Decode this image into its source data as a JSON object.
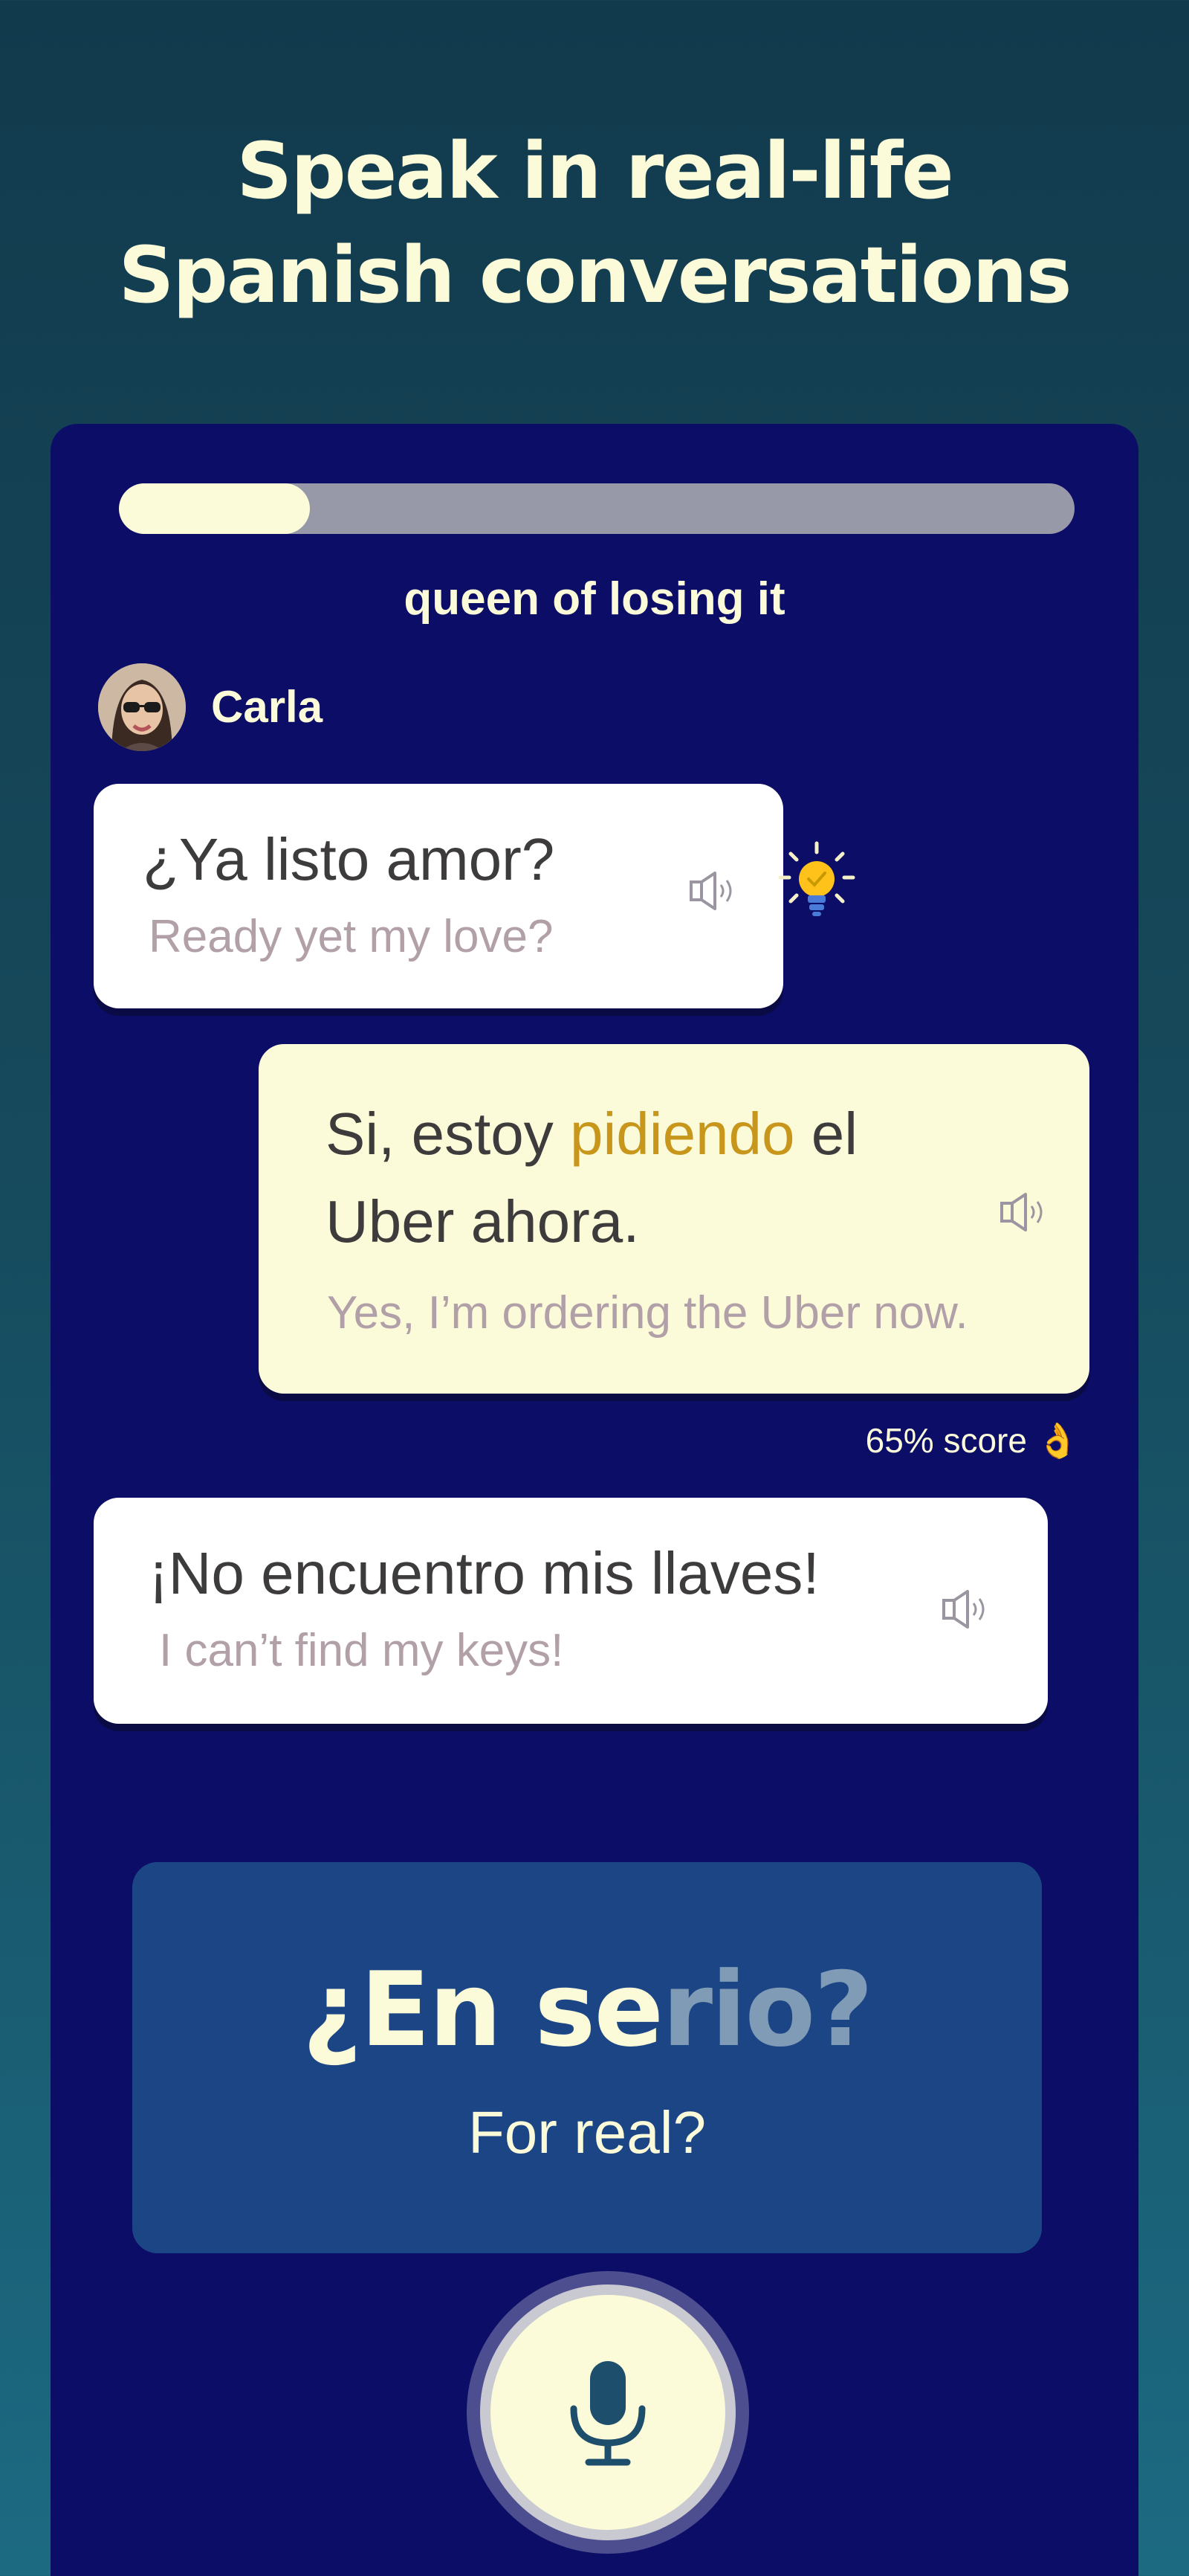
{
  "headline": {
    "line1": "Speak in real-life",
    "line2": "Spanish conversations"
  },
  "lesson": {
    "progress": 0.2,
    "title": "queen of losing it"
  },
  "speaker": {
    "name": "Carla"
  },
  "messages": [
    {
      "from": "Carla",
      "text": "¿Ya listo amor?",
      "translation": "Ready yet my love?"
    },
    {
      "from": "user",
      "text_before": "Si, estoy ",
      "text_highlight": "pidiendo",
      "text_after_line1": " el",
      "text_line2": "Uber ahora.",
      "translation": "Yes, I’m ordering the Uber now.",
      "score": "65% score 👌"
    },
    {
      "from": "Carla",
      "text": "¡No encuentro mis llaves!",
      "translation": "I can’t find my keys!"
    }
  ],
  "current_phrase": {
    "spoken_part": "¿En se",
    "remaining_part": "rio?",
    "translation": "For real?"
  },
  "icons": {
    "hint": "lightbulb-icon",
    "audio": "speaker-icon",
    "record": "microphone-icon"
  },
  "colors": {
    "highlight": "#c7961a",
    "cream": "#fbfbd9",
    "panel": "#0c0d66"
  }
}
